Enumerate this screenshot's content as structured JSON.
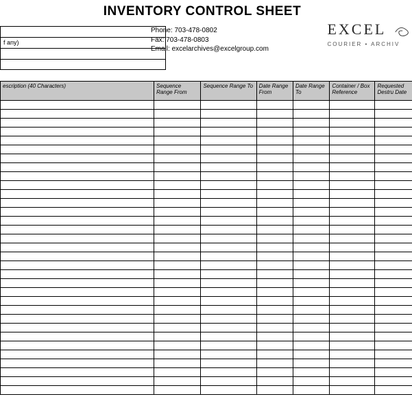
{
  "header": {
    "title": "INVENTORY CONTROL SHEET",
    "info_rows": [
      "",
      "f any)",
      "",
      ""
    ],
    "contact": {
      "phone_label": "Phone:",
      "phone_value": "703-478-0802",
      "fax_label": "Fax:",
      "fax_value": "703-478-0803",
      "email_label": "Email:",
      "email_value": "excelarchives@excelgroup.com"
    },
    "brand": {
      "name": "EXCEL",
      "tagline": "COURIER • ARCHIV"
    }
  },
  "columns": [
    "escription (40 Characters)",
    "Sequence Range From",
    "Sequence Range To",
    "Date Range From",
    "Date Range To",
    "Container / Box Reference",
    "Requested Destru Date"
  ],
  "row_count": 33
}
